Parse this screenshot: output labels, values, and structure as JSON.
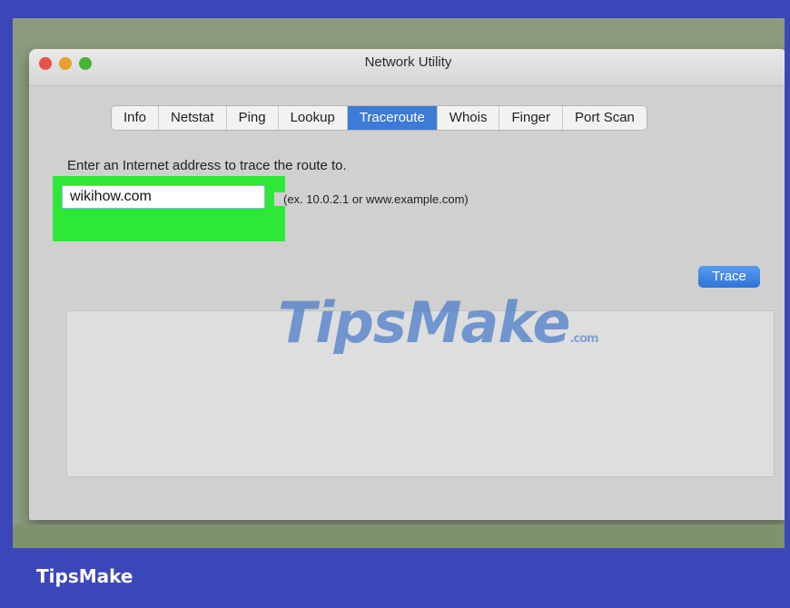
{
  "window": {
    "title": "Network Utility"
  },
  "tabs": [
    "Info",
    "Netstat",
    "Ping",
    "Lookup",
    "Traceroute",
    "Whois",
    "Finger",
    "Port Scan"
  ],
  "active_tab": "Traceroute",
  "traceroute": {
    "prompt": "Enter an Internet address to trace the route to.",
    "address_value": "wikihow.com",
    "hint": "(ex. 10.0.2.1 or www.example.com)",
    "trace_label": "Trace",
    "output": ""
  },
  "watermark": {
    "text": "TipsMake",
    "suffix": ".com"
  },
  "footer": {
    "brand": "TipsMake"
  },
  "colors": {
    "highlight": "#2ee836",
    "accent": "#3c7bd6",
    "frame": "#3b47b8"
  }
}
